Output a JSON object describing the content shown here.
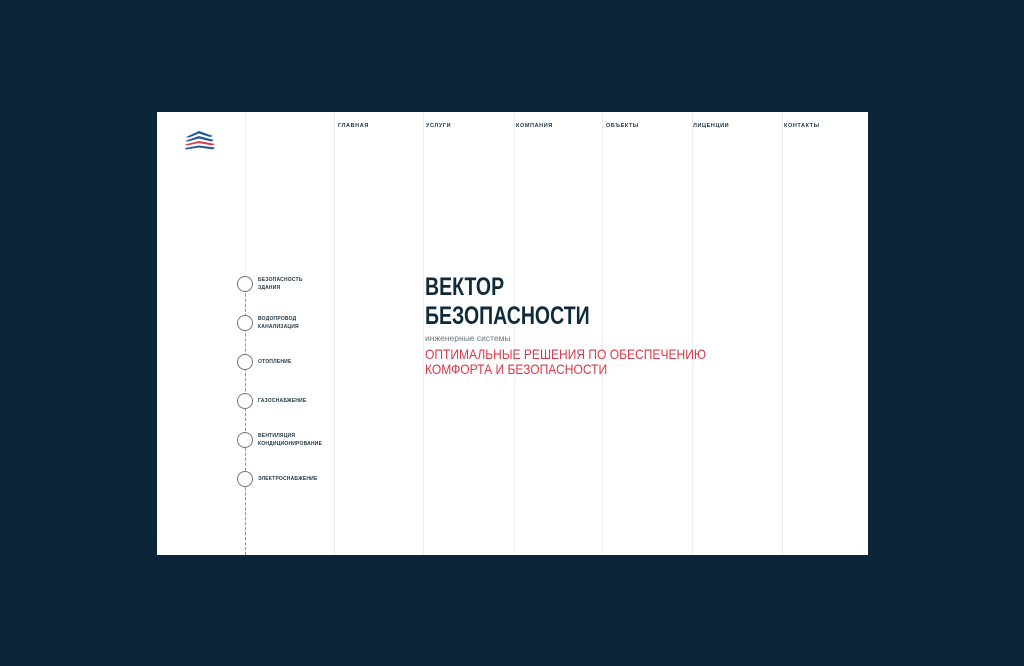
{
  "brand": {
    "logo_icon": "layered-roof-logo-icon",
    "colors": {
      "background": "#0a2638",
      "logo_blue": "#1f5a99",
      "logo_red": "#d93a4b",
      "accent_red": "#d93a4b",
      "title_dark": "#0f2a3a"
    }
  },
  "nav": {
    "items": [
      {
        "label": "ГЛАВНАЯ"
      },
      {
        "label": "УСЛУГИ"
      },
      {
        "label": "КОМПАНИЯ"
      },
      {
        "label": "ОБЪЕКТЫ"
      },
      {
        "label": "ЛИЦЕНЦИИ"
      },
      {
        "label": "КОНТАКТЫ"
      }
    ]
  },
  "services": [
    {
      "line1": "БЕЗОПАСНОСТЬ",
      "line2": "ЗДАНИЯ"
    },
    {
      "line1": "ВОДОПРОВОД",
      "line2": "КАНАЛИЗАЦИЯ"
    },
    {
      "line1": "ОТОПЛЕНИЕ",
      "line2": ""
    },
    {
      "line1": "ГАЗОСНАБЖЕНИЕ",
      "line2": ""
    },
    {
      "line1": "ВЕНТИЛЯЦИЯ",
      "line2": "КОНДИЦИОНИРОВАНИЕ"
    },
    {
      "line1": "ЭЛЕКТРОСНАБЖЕНИЕ",
      "line2": ""
    }
  ],
  "hero": {
    "title_line1": "ВЕКТОР",
    "title_line2": "БЕЗОПАСНОСТИ",
    "subtitle": "инженерные системы",
    "tagline_line1": "ОПТИМАЛЬНЫЕ РЕШЕНИЯ ПО ОБЕСПЕЧЕНИЮ",
    "tagline_line2": "КОМФОРТА И БЕЗОПАСНОСТИ"
  }
}
